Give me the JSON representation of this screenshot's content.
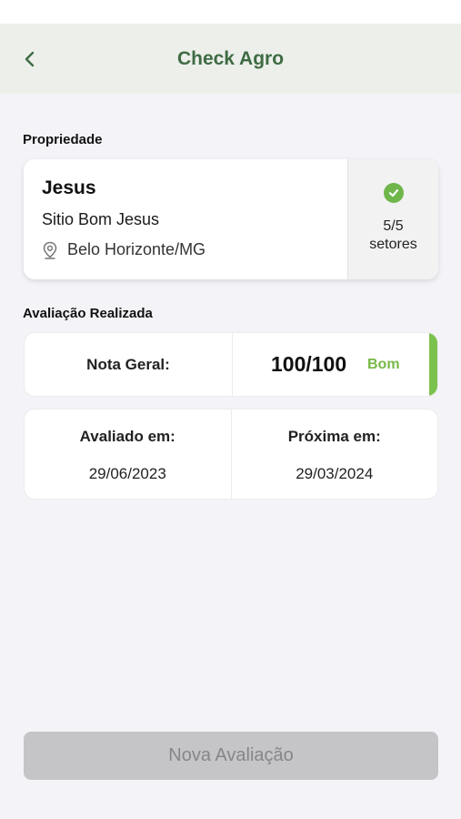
{
  "header": {
    "title": "Check Agro"
  },
  "property_section": {
    "label": "Propriedade",
    "name": "Jesus",
    "farm": "Sitio Bom Jesus",
    "location": "Belo Horizonte/MG",
    "sectors_count": "5/5",
    "sectors_label": "setores"
  },
  "evaluation_section": {
    "label": "Avaliação Realizada",
    "score_label": "Nota Geral:",
    "score_value": "100/100",
    "score_grade": "Bom",
    "evaluated_label": "Avaliado em:",
    "evaluated_date": "29/06/2023",
    "next_label": "Próxima em:",
    "next_date": "29/03/2024"
  },
  "actions": {
    "new_evaluation": "Nova Avaliação"
  },
  "colors": {
    "header_bg": "#ecefea",
    "title": "#3e6b43",
    "accent_green": "#7cc24e",
    "button_disabled": "#c5c5c8"
  },
  "icons": [
    "back-arrow-icon",
    "map-pin-icon",
    "check-circle-icon"
  ]
}
